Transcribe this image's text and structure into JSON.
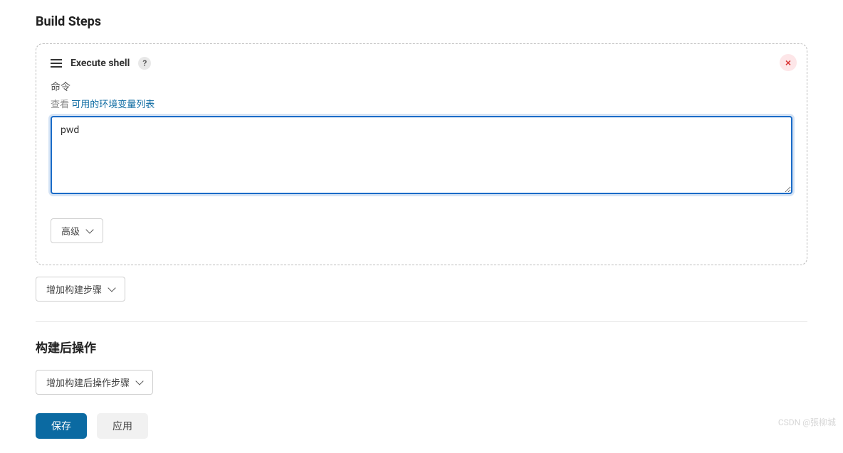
{
  "sections": {
    "build_steps_title": "Build Steps",
    "post_build_title": "构建后操作"
  },
  "step": {
    "title": "Execute shell",
    "field_label": "命令",
    "hint_prefix": "查看",
    "hint_link": "可用的环境变量列表",
    "command_value": "pwd",
    "advanced_label": "高级"
  },
  "buttons": {
    "add_build_step": "增加构建步骤",
    "add_post_build": "增加构建后操作步骤",
    "save": "保存",
    "apply": "应用"
  },
  "watermark": "CSDN @張柳城"
}
